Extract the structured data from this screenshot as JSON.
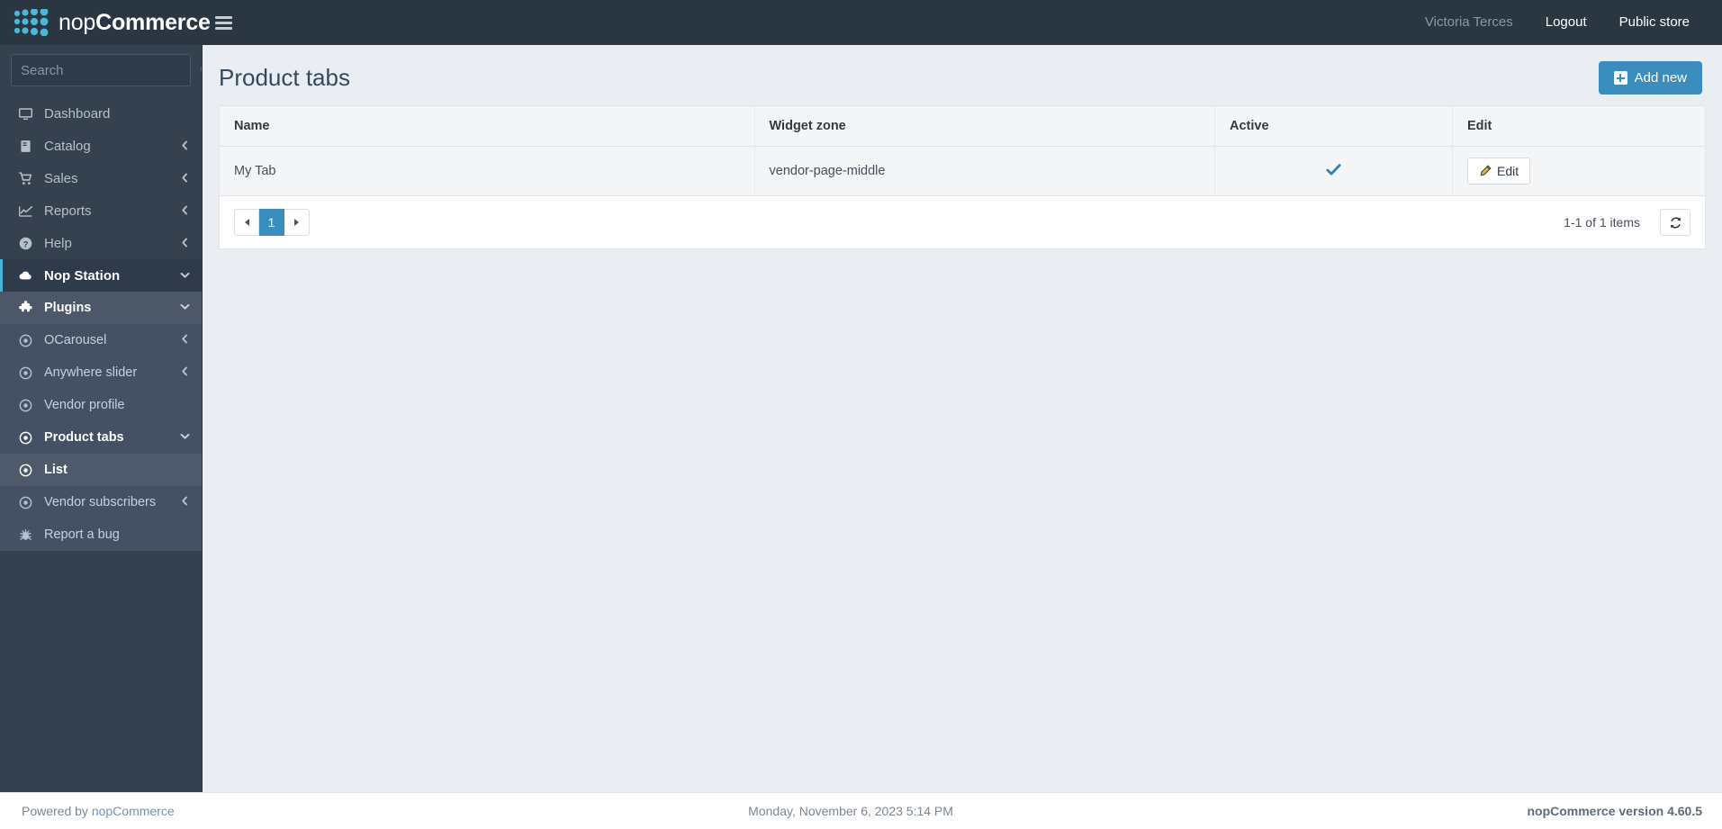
{
  "brand": {
    "name_light": "nop",
    "name_bold": "Commerce"
  },
  "topbar": {
    "menu_toggle_icon": "hamburger-icon",
    "username": "Victoria Terces",
    "logout_label": "Logout",
    "public_store_label": "Public store"
  },
  "sidebar": {
    "search": {
      "placeholder": "Search",
      "value": "",
      "icon": "search-icon"
    },
    "items": [
      {
        "label": "Dashboard",
        "icon": "monitor-icon",
        "level": 1,
        "chevron": "",
        "state": ""
      },
      {
        "label": "Catalog",
        "icon": "book-icon",
        "level": 1,
        "chevron": "left",
        "state": ""
      },
      {
        "label": "Sales",
        "icon": "cart-icon",
        "level": 1,
        "chevron": "left",
        "state": ""
      },
      {
        "label": "Reports",
        "icon": "chart-icon",
        "level": 1,
        "chevron": "left",
        "state": ""
      },
      {
        "label": "Help",
        "icon": "question-icon",
        "level": 1,
        "chevron": "left",
        "state": ""
      },
      {
        "label": "Nop Station",
        "icon": "cloud-icon",
        "level": 1,
        "chevron": "down",
        "state": "open-dark"
      },
      {
        "label": "Plugins",
        "icon": "puzzle-icon",
        "level": 2,
        "chevron": "down",
        "state": "open-mid"
      },
      {
        "label": "OCarousel",
        "icon": "circle-dot-icon",
        "level": 3,
        "chevron": "left",
        "state": "sub"
      },
      {
        "label": "Anywhere slider",
        "icon": "circle-dot-icon",
        "level": 3,
        "chevron": "left",
        "state": "sub"
      },
      {
        "label": "Vendor profile",
        "icon": "circle-dot-icon",
        "level": 3,
        "chevron": "",
        "state": "sub"
      },
      {
        "label": "Product tabs",
        "icon": "circle-dot-icon",
        "level": 3,
        "chevron": "down",
        "state": "sub bold"
      },
      {
        "label": "List",
        "icon": "circle-dot-icon",
        "level": 3,
        "chevron": "",
        "state": "sub active"
      },
      {
        "label": "Vendor subscribers",
        "icon": "circle-dot-icon",
        "level": 3,
        "chevron": "left",
        "state": "sub"
      },
      {
        "label": "Report a bug",
        "icon": "bug-icon",
        "level": 3,
        "chevron": "",
        "state": "plain-sub"
      }
    ]
  },
  "page": {
    "title": "Product tabs",
    "add_new_label": "Add new",
    "add_new_icon": "plus-square-icon"
  },
  "grid": {
    "columns": [
      "Name",
      "Widget zone",
      "Active",
      "Edit"
    ],
    "rows": [
      {
        "name": "My Tab",
        "widget_zone": "vendor-page-middle",
        "active": true,
        "active_icon": "check-icon",
        "edit_label": "Edit",
        "edit_icon": "pencil-icon"
      }
    ]
  },
  "pager": {
    "prev_label": "",
    "pages": [
      "1"
    ],
    "current_page": "1",
    "next_label": "",
    "item_count": "1-1 of 1 items",
    "refresh_icon": "refresh-icon"
  },
  "footer": {
    "powered_by_prefix": "Powered by ",
    "powered_by_link": "nopCommerce",
    "datetime": "Monday, November 6, 2023 5:14 PM",
    "version": "nopCommerce version 4.60.5"
  },
  "colors": {
    "accent": "#3b8dbd",
    "sidebar": "#364150",
    "topbar": "#2b3643",
    "brand_dots": "#4ab8d8",
    "content_bg": "#eaedf2"
  }
}
